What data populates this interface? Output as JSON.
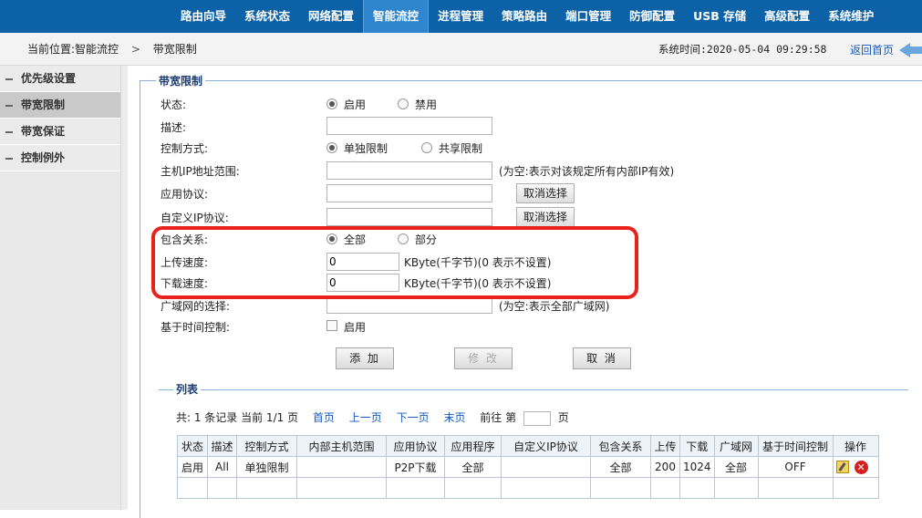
{
  "nav": {
    "items": [
      "路由向导",
      "系统状态",
      "网络配置",
      "智能流控",
      "进程管理",
      "策略路由",
      "端口管理",
      "防御配置",
      "USB 存储",
      "高级配置",
      "系统维护"
    ],
    "active": "智能流控"
  },
  "breadcrumb": {
    "prefix": "当前位置:智能流控",
    "separator": ">",
    "current": "带宽限制"
  },
  "system_time": "系统时间:2020-05-04 09:29:58",
  "back_label": "返回首页",
  "sidebar": {
    "items": [
      "优先级设置",
      "带宽限制",
      "带宽保证",
      "控制例外"
    ],
    "active": "带宽限制"
  },
  "form": {
    "legend": "带宽限制",
    "status": {
      "label": "状态:",
      "opt_enable": "启用",
      "opt_disable": "禁用"
    },
    "desc": {
      "label": "描述:",
      "value": ""
    },
    "control_mode": {
      "label": "控制方式:",
      "opt_single": "单独限制",
      "opt_shared": "共享限制"
    },
    "host_ip": {
      "label": "主机IP地址范围:",
      "value": "",
      "hint": "(为空:表示对该规定所有内部IP有效)"
    },
    "app_protocol": {
      "label": "应用协议:",
      "value": "",
      "button": "取消选择"
    },
    "custom_ip_protocol": {
      "label": "自定义IP协议:",
      "value": "",
      "button": "取消选择"
    },
    "include_relation": {
      "label": "包含关系:",
      "opt_all": "全部",
      "opt_part": "部分"
    },
    "upload_speed": {
      "label": "上传速度:",
      "value": "0",
      "unit": "KByte(千字节)(0 表示不设置)"
    },
    "download_speed": {
      "label": "下载速度:",
      "value": "0",
      "unit": "KByte(千字节)(0 表示不设置)"
    },
    "wan_select": {
      "label": "广域网的选择:",
      "value": "",
      "hint": "(为空:表示全部广域网)"
    },
    "time_control": {
      "label": "基于时间控制:",
      "checkbox_label": "启用"
    },
    "buttons": {
      "add": "添 加",
      "modify": "修 改",
      "cancel": "取 消"
    }
  },
  "list": {
    "legend": "列表",
    "summary": "共: 1 条记录 当前 1/1 页",
    "links": [
      "首页",
      "上一页",
      "下一页",
      "末页"
    ],
    "goto_prefix": "前往 第",
    "goto_suffix": "页",
    "headers": [
      "状态",
      "描述",
      "控制方式",
      "内部主机范围",
      "应用协议",
      "应用程序",
      "自定义IP协议",
      "包含关系",
      "上传",
      "下载",
      "广域网",
      "基于时间控制",
      "操作"
    ],
    "rows": [
      [
        "启用",
        "All",
        "单独限制",
        "",
        "P2P下载",
        "全部",
        "",
        "全部",
        "200",
        "1024",
        "全部",
        "OFF",
        ""
      ]
    ]
  },
  "colors": {
    "nav_bg": "#0d62a7",
    "nav_active": "#2f86cf",
    "highlight_box": "#e8231c",
    "link": "#1659b8"
  }
}
